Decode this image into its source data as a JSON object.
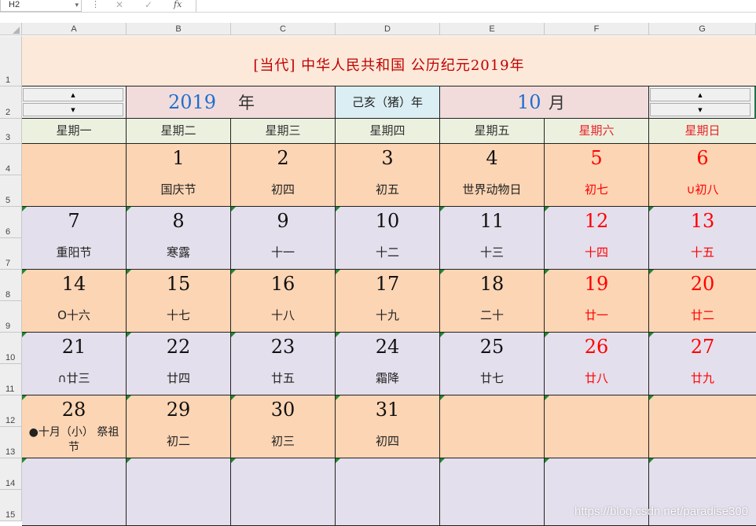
{
  "formula_bar": {
    "name_box": "H2",
    "name_box_dropdown": "▾",
    "separator": "⋮",
    "cancel_glyph": "✕",
    "confirm_glyph": "✓",
    "fx_label": "fx",
    "formula": ""
  },
  "columns": [
    "A",
    "B",
    "C",
    "D",
    "E",
    "F",
    "G"
  ],
  "rows": [
    "1",
    "2",
    "3",
    "4",
    "5",
    "6",
    "7",
    "8",
    "9",
    "10",
    "11",
    "12",
    "13",
    "14",
    "15"
  ],
  "title": "[当代] 中华人民共和国   公历纪元2019年",
  "controls": {
    "year_value": "2019",
    "year_unit": "年",
    "ganzhi": "己亥（猪）年",
    "month_value": "10",
    "month_unit": "月",
    "spin_up": "▲",
    "spin_down": "▼"
  },
  "weekdays": [
    "星期一",
    "星期二",
    "星期三",
    "星期四",
    "星期五",
    "星期六",
    "星期日"
  ],
  "weeks": [
    [
      {
        "num": "",
        "sub": ""
      },
      {
        "num": "1",
        "sub": "国庆节"
      },
      {
        "num": "2",
        "sub": "初四"
      },
      {
        "num": "3",
        "sub": "初五"
      },
      {
        "num": "4",
        "sub": "世界动物日"
      },
      {
        "num": "5",
        "sub": "初七"
      },
      {
        "num": "6",
        "sub": "∪初八"
      }
    ],
    [
      {
        "num": "7",
        "sub": "重阳节"
      },
      {
        "num": "8",
        "sub": "寒露"
      },
      {
        "num": "9",
        "sub": "十一"
      },
      {
        "num": "10",
        "sub": "十二"
      },
      {
        "num": "11",
        "sub": "十三"
      },
      {
        "num": "12",
        "sub": "十四"
      },
      {
        "num": "13",
        "sub": "十五"
      }
    ],
    [
      {
        "num": "14",
        "sub": "O十六"
      },
      {
        "num": "15",
        "sub": "十七"
      },
      {
        "num": "16",
        "sub": "十八"
      },
      {
        "num": "17",
        "sub": "十九"
      },
      {
        "num": "18",
        "sub": "二十"
      },
      {
        "num": "19",
        "sub": "廿一"
      },
      {
        "num": "20",
        "sub": "廿二"
      }
    ],
    [
      {
        "num": "21",
        "sub": "∩廿三"
      },
      {
        "num": "22",
        "sub": "廿四"
      },
      {
        "num": "23",
        "sub": "廿五"
      },
      {
        "num": "24",
        "sub": "霜降"
      },
      {
        "num": "25",
        "sub": "廿七"
      },
      {
        "num": "26",
        "sub": "廿八"
      },
      {
        "num": "27",
        "sub": "廿九"
      }
    ],
    [
      {
        "num": "28",
        "sub": "●十月（小） 祭祖节"
      },
      {
        "num": "29",
        "sub": "初二"
      },
      {
        "num": "30",
        "sub": "初三"
      },
      {
        "num": "31",
        "sub": "初四"
      },
      {
        "num": "",
        "sub": ""
      },
      {
        "num": "",
        "sub": ""
      },
      {
        "num": "",
        "sub": ""
      }
    ],
    [
      {
        "num": "",
        "sub": ""
      },
      {
        "num": "",
        "sub": ""
      },
      {
        "num": "",
        "sub": ""
      },
      {
        "num": "",
        "sub": ""
      },
      {
        "num": "",
        "sub": ""
      },
      {
        "num": "",
        "sub": ""
      },
      {
        "num": "",
        "sub": ""
      }
    ]
  ],
  "colors": {
    "title_red": "#c00000",
    "weekend_red": "#ff0000",
    "accent_blue": "#1f6fcf",
    "peach": "#fcd5b4",
    "lavender": "#e4dfec",
    "weekday_header": "#ebf1de",
    "note_marker": "#1e8a2e"
  },
  "watermark": "https://blog.csdn.net/paradise300"
}
